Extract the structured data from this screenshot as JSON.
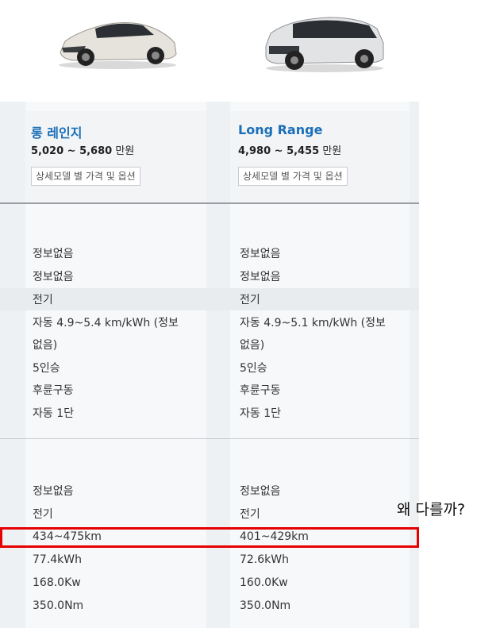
{
  "colors": {
    "title_blue": "#1b6fb8",
    "highlight_red": "#e60000",
    "panel_bg": "#f2f4f6"
  },
  "cars": [
    {
      "image": "car-ev6-image",
      "title": "롱 레인지",
      "price_range": "5,020 ~ 5,680",
      "price_unit": " 만원",
      "options_button": "상세모델 별 가격 및 옵션",
      "specs_a": [
        "정보없음",
        "정보없음",
        "전기",
        "자동 4.9~5.4 km/kWh (정보",
        "없음)",
        "5인승",
        "후륜구동",
        "자동 1단"
      ],
      "specs_b": [
        "정보없음",
        "전기",
        "434~475km",
        "77.4kWh",
        "168.0Kw",
        "350.0Nm"
      ]
    },
    {
      "image": "car-ioniq5-image",
      "title": "Long Range",
      "price_range": "4,980 ~ 5,455",
      "price_unit": " 만원",
      "options_button": "상세모델 별 가격 및 옵션",
      "specs_a": [
        "정보없음",
        "정보없음",
        "전기",
        "자동 4.9~5.1 km/kWh (정보",
        "없음)",
        "5인승",
        "후륜구동",
        "자동 1단"
      ],
      "specs_b": [
        "정보없음",
        "전기",
        "401~429km",
        "72.6kWh",
        "160.0Kw",
        "350.0Nm"
      ]
    }
  ],
  "annotation": "왜 다를까?"
}
